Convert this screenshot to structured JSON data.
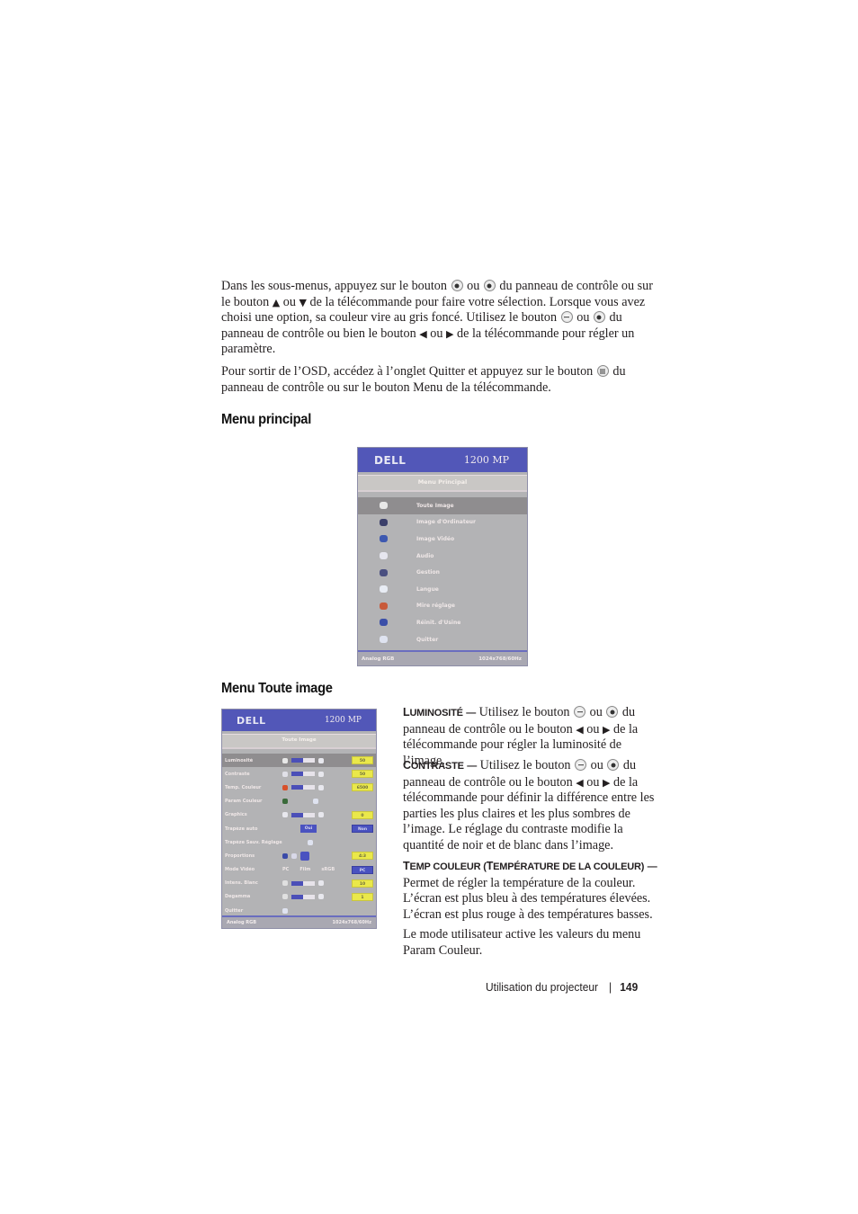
{
  "intro": {
    "p1": {
      "t1": "Dans les sous-menus, appuyez sur le bouton",
      "t2": "ou",
      "t3": "du panneau de contrôle ou sur le bouton",
      "up": "▲",
      "t4": "ou",
      "down": "▼",
      "t5": "de la télécommande pour faire votre sélection. Lorsque vous avez choisi une option, sa couleur vire au gris foncé. Utilisez le bouton",
      "t6": "ou",
      "t7": "du panneau de contrôle ou bien le bouton",
      "left": "◀",
      "t8": "ou",
      "right": "▶",
      "t9": "de la télécommande pour régler un paramètre."
    },
    "p2": {
      "t1": "Pour sortir de l’OSD, accédez à l’onglet Quitter et appuyez sur le bouton",
      "t2": "du panneau de contrôle ou sur le bouton Menu de la télécommande."
    }
  },
  "sections": {
    "main_menu_heading": "Menu principal",
    "all_image_heading": "Menu Toute image"
  },
  "osd_main": {
    "logo": "DELL",
    "model": "1200 MP",
    "title": "Menu Principal",
    "items": [
      {
        "label": "Toute Image",
        "icon": "image-icon",
        "color": "#e8e8e8"
      },
      {
        "label": "Image d'Ordinateur",
        "icon": "computer-icon",
        "color": "#3b3f6a"
      },
      {
        "label": "Image Vidéo",
        "icon": "video-icon",
        "color": "#3d58b0"
      },
      {
        "label": "Audio",
        "icon": "audio-icon",
        "color": "#e6e6ef"
      },
      {
        "label": "Gestion",
        "icon": "management-icon",
        "color": "#4a4f80"
      },
      {
        "label": "Langue",
        "icon": "language-icon",
        "color": "#e8ecf4"
      },
      {
        "label": "Mire réglage",
        "icon": "test-pattern-icon",
        "color": "#c85a3a"
      },
      {
        "label": "Réinit. d'Usine",
        "icon": "factory-reset-icon",
        "color": "#3b4fa8"
      },
      {
        "label": "Quitter",
        "icon": "exit-icon",
        "color": "#dfe3f0"
      }
    ],
    "selected_index": 0,
    "footer_left": "Analog RGB",
    "footer_right": "1024x768/60Hz"
  },
  "osd_all_image": {
    "logo": "DELL",
    "model": "1200 MP",
    "title": "Toute Image",
    "rows": [
      {
        "label": "Luminosité",
        "type": "slider",
        "value": "50",
        "level": 0.5,
        "selected": true
      },
      {
        "label": "Contraste",
        "type": "slider",
        "value": "50",
        "level": 0.5
      },
      {
        "label": "Temp. Couleur",
        "type": "slider",
        "value": "6500",
        "level": 0.5
      },
      {
        "label": "Param Couleur",
        "type": "none",
        "value": ""
      },
      {
        "label": "Graphics",
        "type": "slider",
        "value": "0",
        "level": 0.5
      },
      {
        "label": "Trapèze auto",
        "type": "chip",
        "chip": "Oui",
        "value": "Non",
        "value_style": "blue"
      },
      {
        "label": "Trapèze Sauv. Réglage",
        "type": "none",
        "value": ""
      },
      {
        "label": "Proportions",
        "type": "icons",
        "value": "4:3"
      },
      {
        "label": "Mode Vidéo",
        "type": "text",
        "options": [
          "PC",
          "Film",
          "sRGB"
        ],
        "value": "PC",
        "value_style": "blue"
      },
      {
        "label": "Intens. Blanc",
        "type": "slider",
        "value": "10",
        "level": 0.5
      },
      {
        "label": "Degamma",
        "type": "slider",
        "value": "1",
        "level": 0.5
      },
      {
        "label": "Quitter",
        "type": "none",
        "value": ""
      }
    ],
    "footer_left": "Analog RGB",
    "footer_right": "1024x768/60Hz"
  },
  "descriptions": {
    "luminosite": {
      "term": "Luminosité",
      "dash": "—",
      "t1": "Utilisez le bouton",
      "t2": "ou",
      "t3": "du panneau de contrôle ou le bouton",
      "left": "◀",
      "t4": "ou",
      "right": "▶",
      "t5": "de la télécommande pour régler la luminosité de l’image."
    },
    "contraste": {
      "term": "Contraste",
      "dash": "—",
      "t1": "Utilisez le bouton",
      "t2": "ou",
      "t3": "du panneau de contrôle ou le bouton",
      "left": "◀",
      "t4": "ou",
      "right": "▶",
      "t5": "de la télécommande pour définir la différence entre les parties les plus claires et les plus sombres de l’image. Le réglage du contraste modifie la quantité de noir et de blanc dans l’image."
    },
    "temp_couleur": {
      "term": "Temp couleur (Température de la couleur)",
      "dash": "—",
      "text": "Permet de régler la température de la couleur. L’écran est plus bleu à des températures élevées. L’écran est plus rouge à des températures basses."
    },
    "user_mode": "Le mode utilisateur active les valeurs du menu Param Couleur."
  },
  "footer": {
    "section": "Utilisation du projecteur",
    "separator": "|",
    "page_number": "149"
  }
}
